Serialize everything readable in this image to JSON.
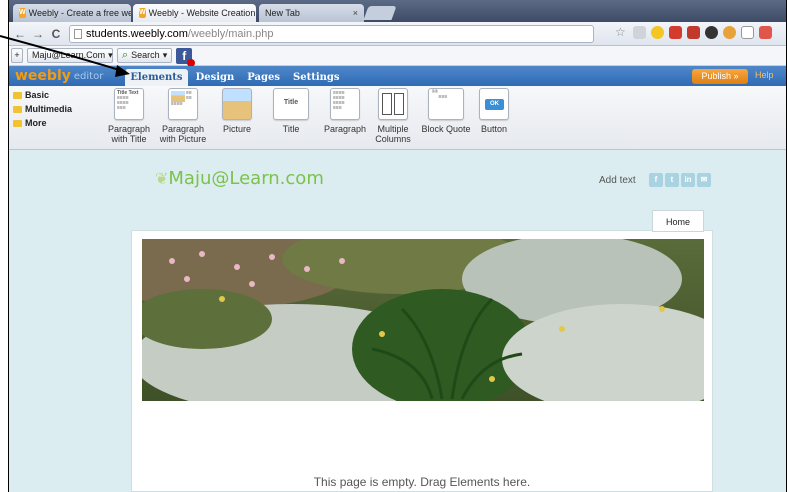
{
  "browser": {
    "tabs": [
      {
        "label": "Weebly - Create a free we",
        "close": "×"
      },
      {
        "label": "Weebly - Website Creation",
        "close": "×"
      },
      {
        "label": "New Tab",
        "close": "×"
      }
    ],
    "back": "←",
    "forward": "→",
    "reload": "C",
    "url_host": "students.weebly.com",
    "url_path": "/weebly/main.php"
  },
  "bookmarks": {
    "site_select": "Maju@Learn.Com",
    "search_label": "Search"
  },
  "editor": {
    "logo": "weebly",
    "logo_suffix": "editor",
    "tabs": [
      "Elements",
      "Design",
      "Pages",
      "Settings"
    ],
    "publish": "Publish »",
    "help": "Help"
  },
  "panel": {
    "categories": [
      "Basic",
      "Multimedia",
      "More"
    ],
    "elements": [
      {
        "label": "Paragraph with Title",
        "thumb": "Title Text"
      },
      {
        "label": "Paragraph with Picture",
        "thumb": ""
      },
      {
        "label": "Picture",
        "thumb": ""
      },
      {
        "label": "Title",
        "thumb": "Title Text"
      },
      {
        "label": "Paragraph",
        "thumb": ""
      },
      {
        "label": "Multiple Columns",
        "thumb": ""
      },
      {
        "label": "Block Quote",
        "thumb": ""
      },
      {
        "label": "Button",
        "thumb": "OK"
      }
    ]
  },
  "site": {
    "title": "Maju@Learn.com",
    "add_text": "Add text",
    "social": [
      "f",
      "t",
      "in",
      "✉"
    ],
    "nav_home": "Home",
    "empty_message": "This page is empty. Drag Elements here."
  },
  "colors": {
    "editor_bar": "#3a75bd",
    "publish": "#f29a2e",
    "site_title": "#7cc24a",
    "canvas_bg": "#dcedf2"
  }
}
